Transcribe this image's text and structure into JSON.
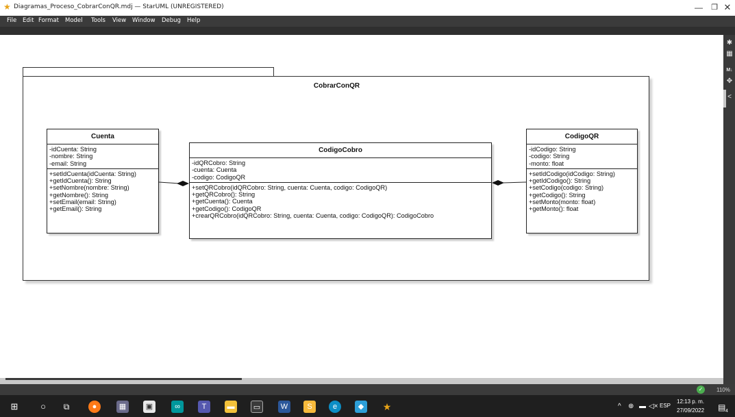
{
  "window": {
    "title": "Diagramas_Proceso_CobrarConQR.mdj — StarUML (UNREGISTERED)",
    "minimize": "—",
    "maximize": "❐",
    "close": "✕"
  },
  "menu": [
    "File",
    "Edit",
    "Format",
    "Model",
    "Tools",
    "View",
    "Window",
    "Debug",
    "Help"
  ],
  "diagram": {
    "frame_title": "CobrarConQR",
    "classes": {
      "cuenta": {
        "name": "Cuenta",
        "attributes": [
          "-idCuenta: String",
          "-nombre: String",
          "-email: String"
        ],
        "operations": [
          "+setIdCuenta(idCuenta: String)",
          "+getIdCuenta(): String",
          "+setNombre(nombre: String)",
          "+getNombre(): String",
          "+setEmail(email: String)",
          "+getEmail(): String"
        ]
      },
      "codigo_cobro": {
        "name": "CodigoCobro",
        "attributes": [
          "-idQRCobro: String",
          "-cuenta: Cuenta",
          "-codigo: CodigoQR"
        ],
        "operations": [
          "+setQRCobro(idQRCobro: String, cuenta: Cuenta, codigo: CodigoQR)",
          "+getQRCobro(): String",
          "+getCuenta(): Cuenta",
          "+getCodigo(): CodigoQR",
          "+crearQRCobro(idQRCobro: String, cuenta: Cuenta, codigo: CodigoQR): CodigoCobro"
        ]
      },
      "codigo_qr": {
        "name": "CodigoQR",
        "attributes": [
          "-idCodigo: String",
          "-codigo: String",
          "-monto: float"
        ],
        "operations": [
          "+setIdCodigo(idCodigo: String)",
          "+getIdCodigo(): String",
          "+setCodigo(codigo: String)",
          "+getCodigo(): String",
          "+setMonto(monto: float)",
          "+getMonto(): float"
        ]
      }
    }
  },
  "status": {
    "zoom": "110%"
  },
  "taskbar": {
    "language": "ESP",
    "time": "12:13 p. m.",
    "date": "27/09/2022",
    "notifications": "4"
  },
  "colors": {
    "menubar": "#3b3b3b",
    "accent_star": "#e8a317",
    "status_ok": "#4caf50"
  }
}
